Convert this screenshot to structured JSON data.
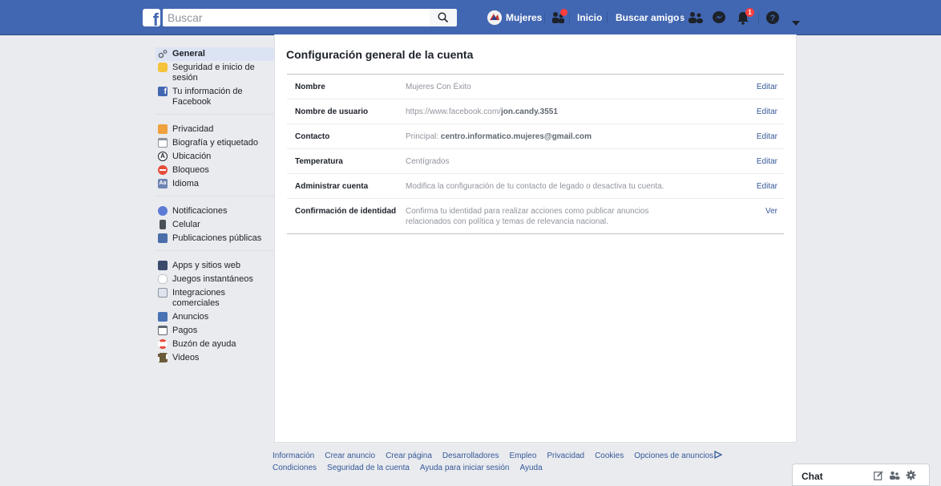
{
  "topbar": {
    "logo": "f",
    "search_placeholder": "Buscar",
    "profile_name": "Mujeres",
    "home": "Inicio",
    "find_friends": "Buscar amigos",
    "notifications_badge": "1",
    "brand_color": "#4267b2"
  },
  "sidebar": {
    "groups": [
      [
        {
          "label": "General",
          "icon": "gears-icon",
          "active": true
        },
        {
          "label": "Seguridad e inicio de sesión",
          "icon": "shield-icon"
        },
        {
          "label": "Tu información de Facebook",
          "icon": "facebook-icon"
        }
      ],
      [
        {
          "label": "Privacidad",
          "icon": "lock-icon"
        },
        {
          "label": "Biografía y etiquetado",
          "icon": "timeline-icon"
        },
        {
          "label": "Ubicación",
          "icon": "location-icon"
        },
        {
          "label": "Bloqueos",
          "icon": "block-icon"
        },
        {
          "label": "Idioma",
          "icon": "language-icon"
        }
      ],
      [
        {
          "label": "Notificaciones",
          "icon": "globe-icon"
        },
        {
          "label": "Celular",
          "icon": "phone-icon"
        },
        {
          "label": "Publicaciones públicas",
          "icon": "rss-icon"
        }
      ],
      [
        {
          "label": "Apps y sitios web",
          "icon": "apps-icon"
        },
        {
          "label": "Juegos instantáneos",
          "icon": "gamepad-icon"
        },
        {
          "label": "Integraciones comerciales",
          "icon": "business-icon"
        },
        {
          "label": "Anuncios",
          "icon": "ads-icon"
        },
        {
          "label": "Pagos",
          "icon": "card-icon"
        },
        {
          "label": "Buzón de ayuda",
          "icon": "lifebuoy-icon"
        },
        {
          "label": "Videos",
          "icon": "film-icon"
        }
      ]
    ]
  },
  "main": {
    "title": "Configuración general de la cuenta",
    "rows": [
      {
        "label": "Nombre",
        "value": "Mujeres Con Éxito",
        "action": "Editar"
      },
      {
        "label": "Nombre de usuario",
        "value_prefix": "https://www.facebook.com/",
        "value_strong": "jon.candy.3551",
        "action": "Editar"
      },
      {
        "label": "Contacto",
        "value_prefix": "Principal: ",
        "value_strong": "centro.informatico.mujeres@gmail.com",
        "action": "Editar"
      },
      {
        "label": "Temperatura",
        "value": "Centígrados",
        "action": "Editar"
      },
      {
        "label": "Administrar cuenta",
        "value": "Modifica la configuración de tu contacto de legado o desactiva tu cuenta.",
        "action": "Editar"
      },
      {
        "label": "Confirmación de identidad",
        "value": "Confirma tu identidad para realizar acciones como publicar anuncios relacionados con política y temas de relevancia nacional.",
        "action": "Ver"
      }
    ]
  },
  "footer": {
    "links_row1": [
      "Información",
      "Crear anuncio",
      "Crear página",
      "Desarrolladores",
      "Empleo",
      "Privacidad",
      "Cookies",
      "Opciones de anuncios"
    ],
    "links_row2": [
      "Condiciones",
      "Seguridad de la cuenta",
      "Ayuda para iniciar sesión",
      "Ayuda"
    ]
  },
  "chat": {
    "label": "Chat"
  }
}
